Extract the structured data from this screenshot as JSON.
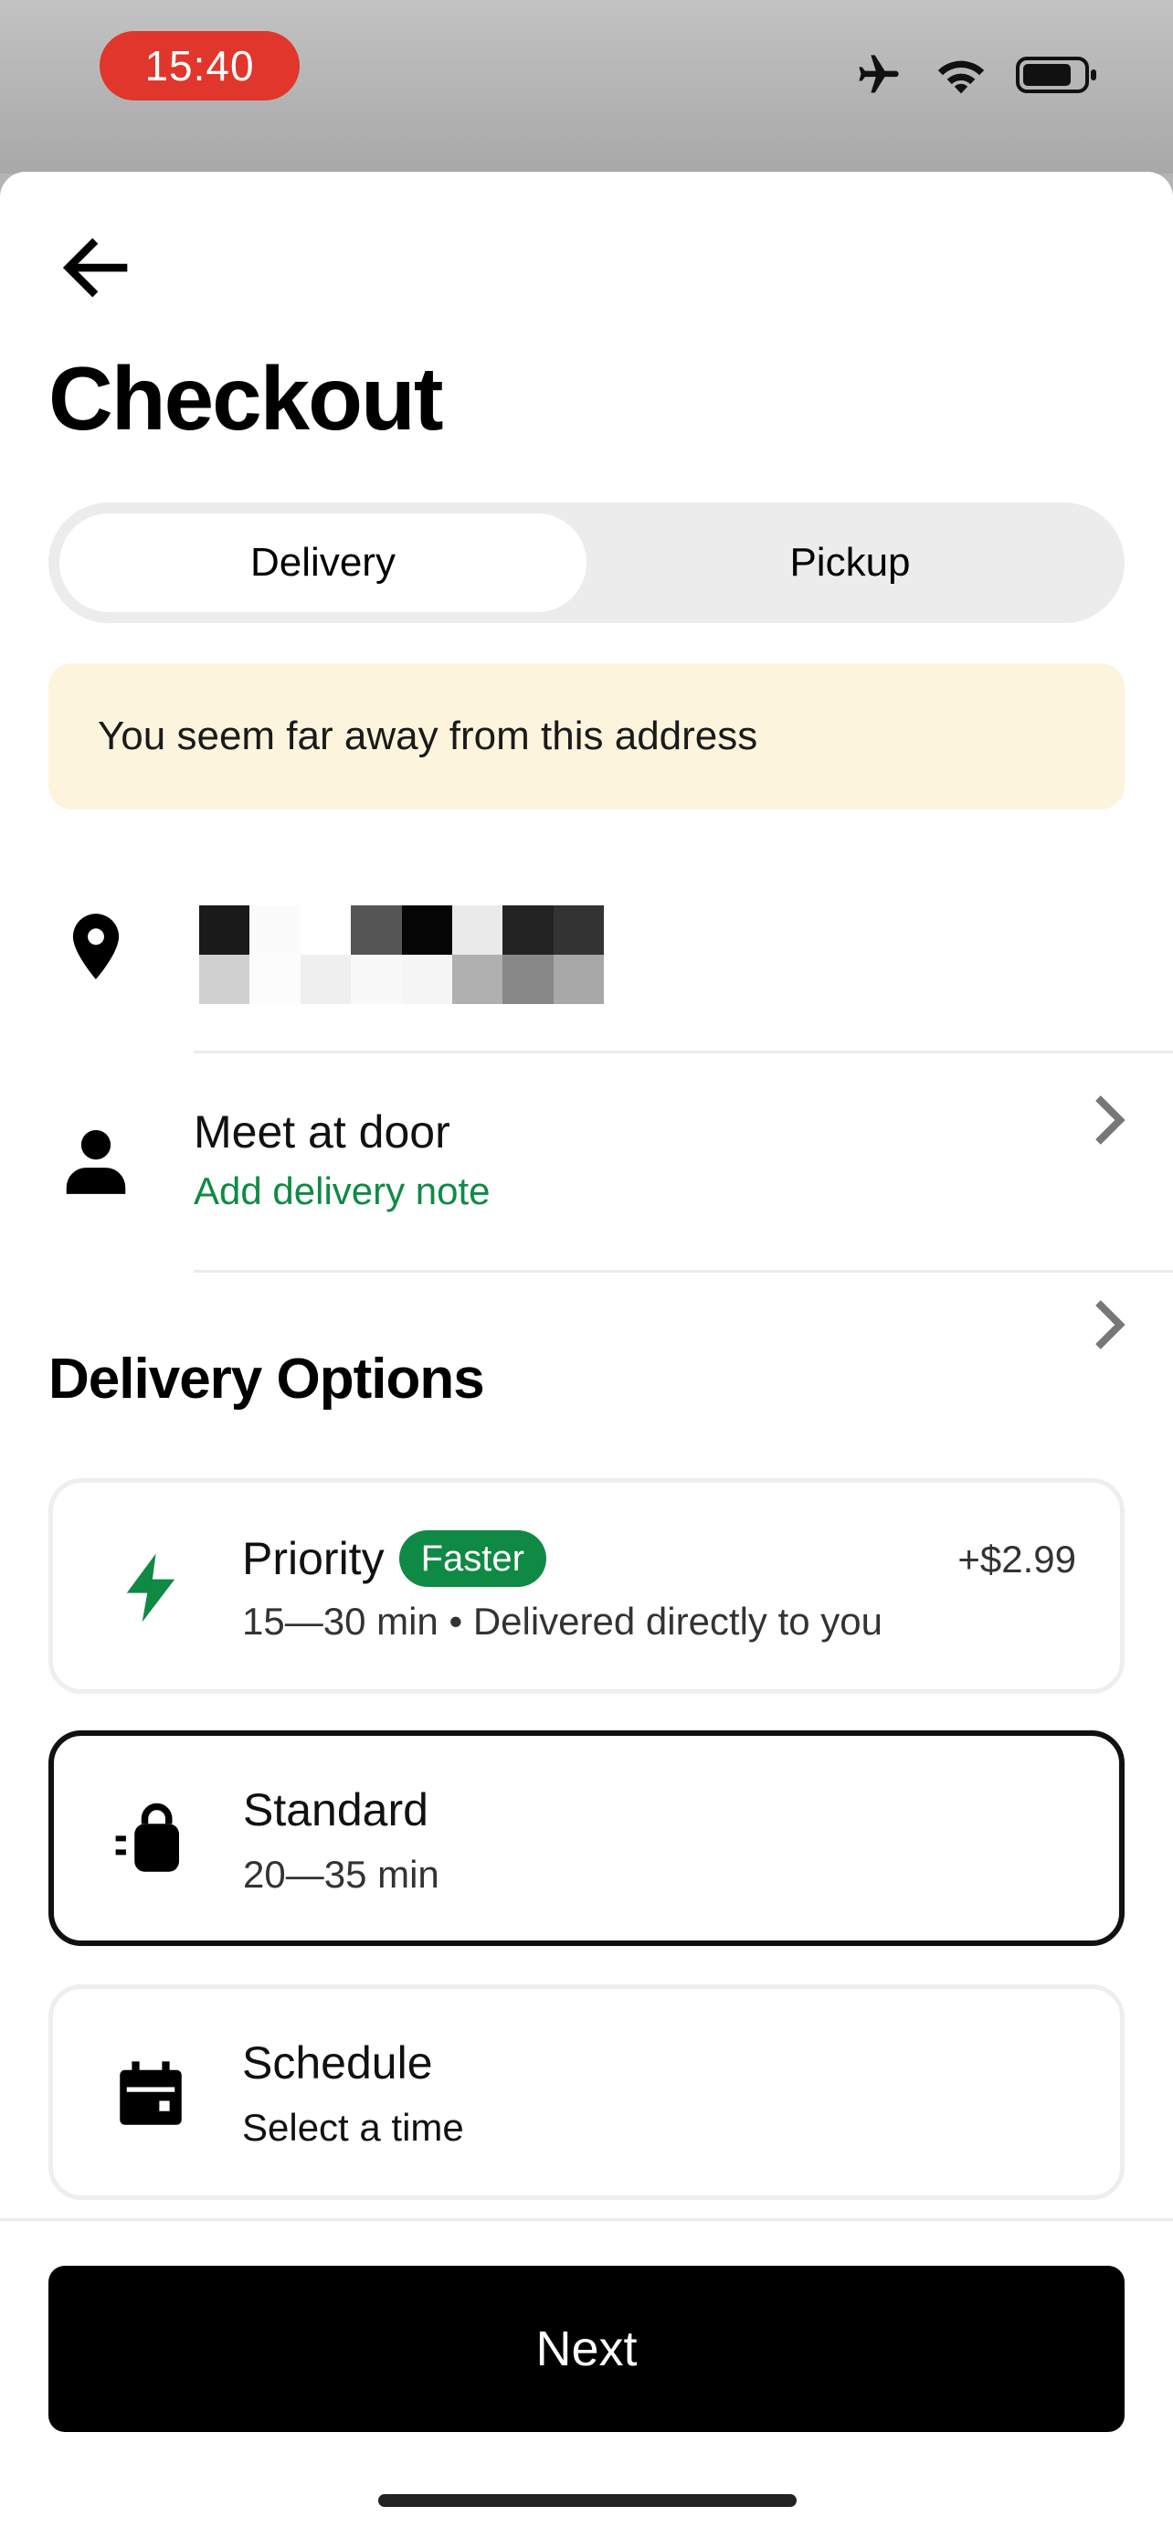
{
  "status_bar": {
    "time": "15:40"
  },
  "header": {
    "title": "Checkout"
  },
  "fulfillment_toggle": {
    "delivery": "Delivery",
    "pickup": "Pickup",
    "selected": "Delivery"
  },
  "warning": {
    "text": "You seem far away from this address"
  },
  "address_row": {
    "icon": "location-pin-icon"
  },
  "dropoff_row": {
    "label": "Meet at door",
    "sub_label": "Add delivery note",
    "icon": "person-icon"
  },
  "delivery_options": {
    "heading": "Delivery Options",
    "options": [
      {
        "name": "Priority",
        "badge": "Faster",
        "detail": "15—30 min • Delivered directly to you",
        "price": "+$2.99",
        "icon": "lightning-icon",
        "selected": false
      },
      {
        "name": "Standard",
        "detail": "20—35 min",
        "icon": "delivery-bag-icon",
        "selected": true
      },
      {
        "name": "Schedule",
        "detail": "Select a time",
        "icon": "calendar-icon",
        "selected": false
      }
    ]
  },
  "footer": {
    "next_label": "Next"
  },
  "colors": {
    "accent_green": "#0e8a45",
    "warning_bg": "#fdf4dd",
    "primary_button": "#000000",
    "time_pill": "#e0362c"
  }
}
